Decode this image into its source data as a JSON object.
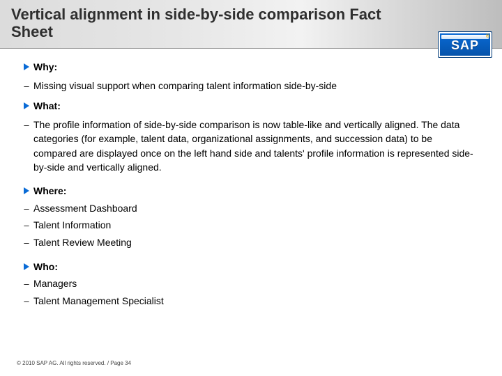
{
  "header": {
    "title": "Vertical alignment in side-by-side comparison Fact Sheet"
  },
  "logo": {
    "text": "SAP"
  },
  "sections": {
    "why": {
      "label": "Why:",
      "item": "Missing visual support when comparing talent information side-by-side"
    },
    "what": {
      "label": "What:",
      "item": "The profile information of side-by-side comparison is now table-like and vertically aligned. The data categories (for example, talent data, organizational assignments, and succession data) to be compared are displayed once on the left hand side and talents' profile information is represented side-by-side and vertically aligned."
    },
    "where": {
      "label": "Where:",
      "items": [
        "Assessment Dashboard",
        "Talent Information",
        "Talent Review Meeting"
      ]
    },
    "who": {
      "label": "Who:",
      "items": [
        "Managers",
        "Talent Management Specialist"
      ]
    }
  },
  "footer": {
    "text": "© 2010 SAP AG. All rights reserved. / Page 34"
  }
}
